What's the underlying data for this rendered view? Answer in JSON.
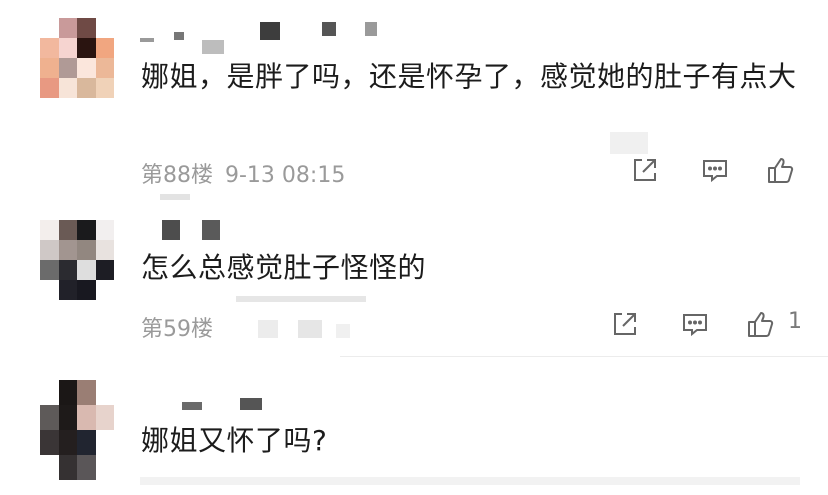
{
  "comments": [
    {
      "text": "娜姐，是胖了吗，还是怀孕了，感觉她的肚子有点大",
      "floor": "第88楼",
      "time": "9-13 08:15",
      "like_count": ""
    },
    {
      "text": "怎么总感觉肚子怪怪的",
      "floor": "第59楼",
      "time": "",
      "like_count": "1"
    },
    {
      "text": "娜姐又怀了吗?",
      "floor": "",
      "time": "",
      "like_count": ""
    }
  ],
  "icons": {
    "share": "share-icon",
    "reply": "comment-icon",
    "like": "thumbs-up-icon"
  },
  "colors": {
    "text": "#1c1c1c",
    "meta": "#9a9a9a",
    "icon": "#666666",
    "divider": "#ececec"
  }
}
